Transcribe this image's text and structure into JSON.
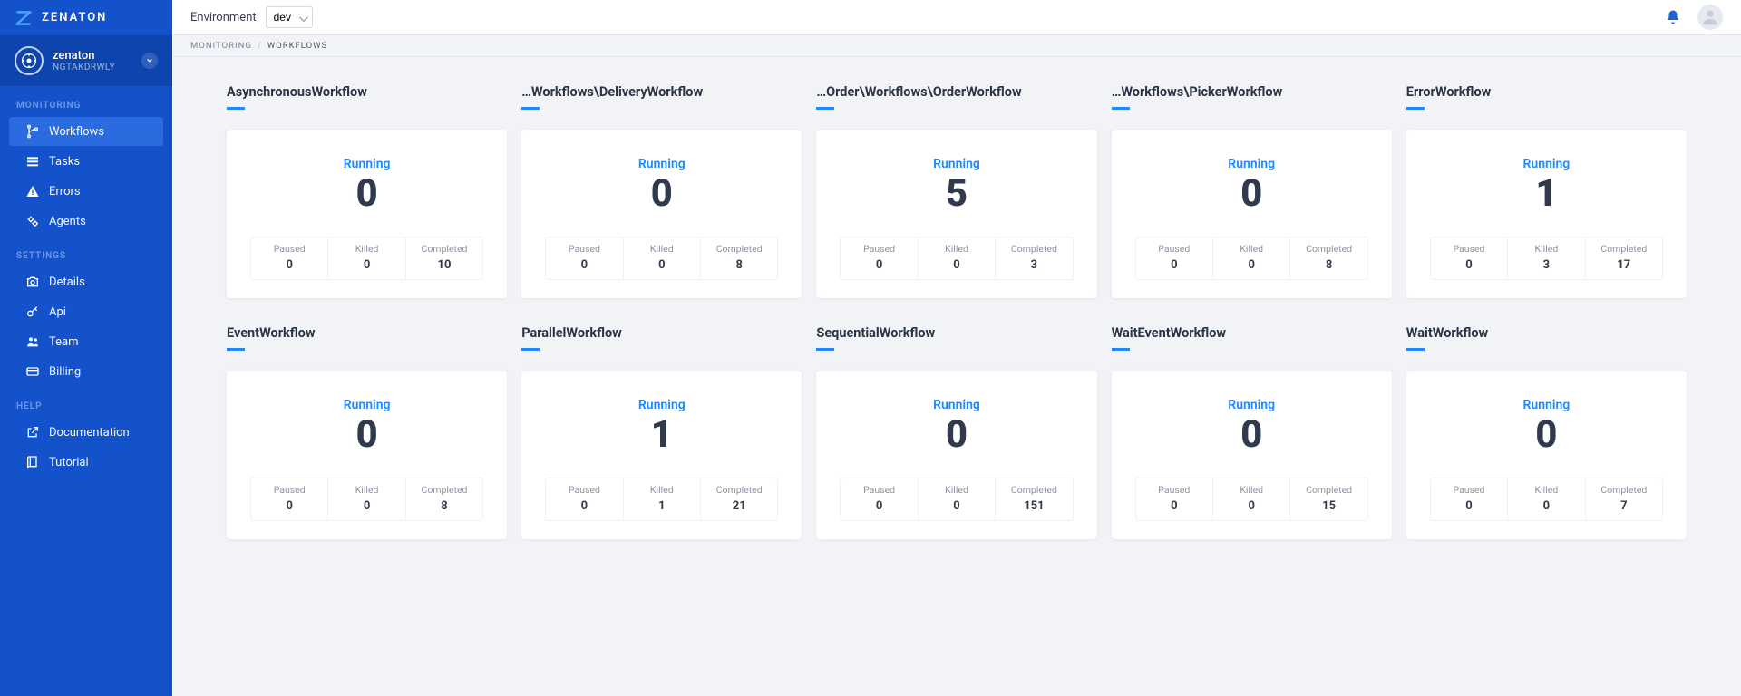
{
  "brand": "ZENATON",
  "org": {
    "name": "zenaton",
    "id": "NGTAKDRWLY"
  },
  "sidebar": {
    "sections": [
      {
        "label": "MONITORING",
        "items": [
          {
            "icon": "branch-icon",
            "label": "Workflows",
            "active": true
          },
          {
            "icon": "list-icon",
            "label": "Tasks"
          },
          {
            "icon": "warning-icon",
            "label": "Errors"
          },
          {
            "icon": "gears-icon",
            "label": "Agents"
          }
        ]
      },
      {
        "label": "SETTINGS",
        "items": [
          {
            "icon": "camera-icon",
            "label": "Details"
          },
          {
            "icon": "key-icon",
            "label": "Api"
          },
          {
            "icon": "people-icon",
            "label": "Team"
          },
          {
            "icon": "card-icon",
            "label": "Billing"
          }
        ]
      },
      {
        "label": "HELP",
        "items": [
          {
            "icon": "external-icon",
            "label": "Documentation"
          },
          {
            "icon": "book-icon",
            "label": "Tutorial"
          }
        ]
      }
    ]
  },
  "topbar": {
    "env_label": "Environment",
    "env_value": "dev"
  },
  "breadcrumb": [
    "MONITORING",
    "WORKFLOWS"
  ],
  "card_labels": {
    "running": "Running",
    "paused": "Paused",
    "killed": "Killed",
    "completed": "Completed"
  },
  "workflows": [
    {
      "title": "AsynchronousWorkflow",
      "running": 0,
      "paused": 0,
      "killed": 0,
      "completed": 10
    },
    {
      "title": "…Workflows\\DeliveryWorkflow",
      "running": 0,
      "paused": 0,
      "killed": 0,
      "completed": 8
    },
    {
      "title": "…Order\\Workflows\\OrderWorkflow",
      "running": 5,
      "paused": 0,
      "killed": 0,
      "completed": 3
    },
    {
      "title": "…Workflows\\PickerWorkflow",
      "running": 0,
      "paused": 0,
      "killed": 0,
      "completed": 8
    },
    {
      "title": "ErrorWorkflow",
      "running": 1,
      "paused": 0,
      "killed": 3,
      "completed": 17
    },
    {
      "title": "EventWorkflow",
      "running": 0,
      "paused": 0,
      "killed": 0,
      "completed": 8
    },
    {
      "title": "ParallelWorkflow",
      "running": 1,
      "paused": 0,
      "killed": 1,
      "completed": 21
    },
    {
      "title": "SequentialWorkflow",
      "running": 0,
      "paused": 0,
      "killed": 0,
      "completed": 151
    },
    {
      "title": "WaitEventWorkflow",
      "running": 0,
      "paused": 0,
      "killed": 0,
      "completed": 15
    },
    {
      "title": "WaitWorkflow",
      "running": 0,
      "paused": 0,
      "killed": 0,
      "completed": 7
    }
  ]
}
